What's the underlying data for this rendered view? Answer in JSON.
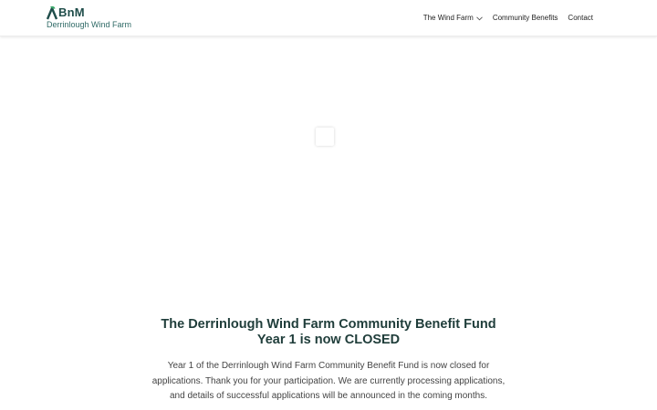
{
  "header": {
    "logo": {
      "brand": "BnM",
      "subtitle": "Derrinlough Wind Farm",
      "brand_color": "#1f4d4a",
      "accent_color": "#3ba86a"
    },
    "nav": {
      "items": [
        {
          "label": "The Wind Farm",
          "has_dropdown": true,
          "icon": "chevron-down-icon"
        },
        {
          "label": "Community Benefits",
          "has_dropdown": false
        },
        {
          "label": "Contact",
          "has_dropdown": false
        }
      ]
    }
  },
  "main": {
    "headline": "The Derrinlough Wind Farm Community Benefit Fund Year 1 is now CLOSED",
    "body": "Year 1 of the Derrinlough Wind Farm Community Benefit Fund is now closed for applications.  Thank you for your participation. We are currently processing applications, and details of successful applications will be announced in the coming months."
  },
  "colors": {
    "heading": "#1f3d3a",
    "text": "#444444",
    "background": "#ffffff"
  }
}
